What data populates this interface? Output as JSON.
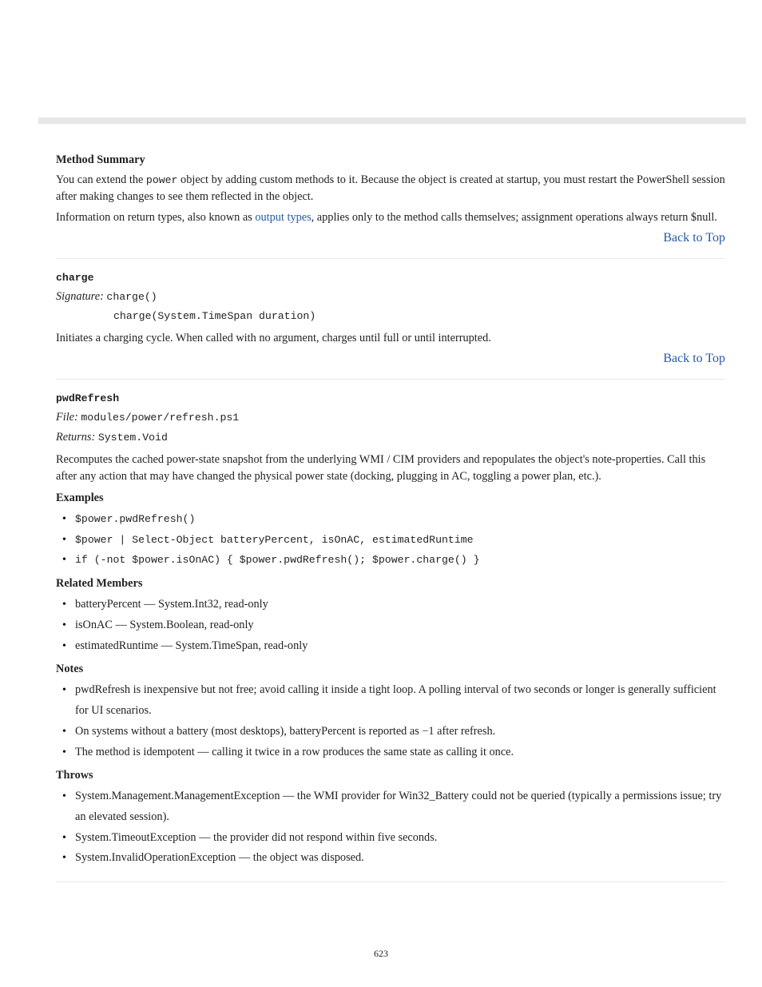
{
  "intro": {
    "heading": "Method Summary",
    "p1_a": "You can extend the ",
    "p1_obj": "power",
    "p1_b": " object by adding custom methods to it. Because the object is created at startup, you must restart the PowerShell session after making changes to see them reflected in the object.",
    "p2_a": "Information on return types, also known as ",
    "p2_link": "output types",
    "p2_b": ", applies only to the method calls themselves; assignment operations always return $null."
  },
  "nav": {
    "back": "Back to Top"
  },
  "term1": {
    "name": "charge",
    "sig_label": "Signature:",
    "sig_a": "charge()",
    "sig_b": "charge(System.TimeSpan duration)",
    "desc": "Initiates a charging cycle. When called with no argument, charges until full or until interrupted."
  },
  "term2": {
    "name": "pwdRefresh",
    "file_label": "File:",
    "file_value": "modules/power/refresh.ps1",
    "rt_label": "Returns:",
    "rt_value": "System.Void",
    "def": "Recomputes the cached power-state snapshot from the underlying WMI / CIM providers and repopulates the object's note-properties. Call this after any action that may have changed the physical power state (docking, plugging in AC, toggling a power plan, etc.).",
    "examples_head": "Examples",
    "examples": [
      "$power.pwdRefresh()",
      "$power | Select-Object batteryPercent, isOnAC, estimatedRuntime",
      "if (-not $power.isOnAC) { $power.pwdRefresh(); $power.charge() }"
    ],
    "related_head": "Related Members",
    "related": [
      "batteryPercent — System.Int32, read-only",
      "isOnAC — System.Boolean, read-only",
      "estimatedRuntime — System.TimeSpan, read-only"
    ],
    "notes_head": "Notes",
    "notes": [
      "pwdRefresh is inexpensive but not free; avoid calling it inside a tight loop. A polling interval of two seconds or longer is generally sufficient for UI scenarios.",
      "On systems without a battery (most desktops), batteryPercent is reported as −1 after refresh.",
      "The method is idempotent — calling it twice in a row produces the same state as calling it once."
    ],
    "throws_head": "Throws",
    "throws": [
      "System.Management.ManagementException — the WMI provider for Win32_Battery could not be queried (typically a permissions issue; try an elevated session).",
      "System.TimeoutException — the provider did not respond within five seconds.",
      "System.InvalidOperationException — the object was disposed."
    ]
  },
  "page_number": "623"
}
